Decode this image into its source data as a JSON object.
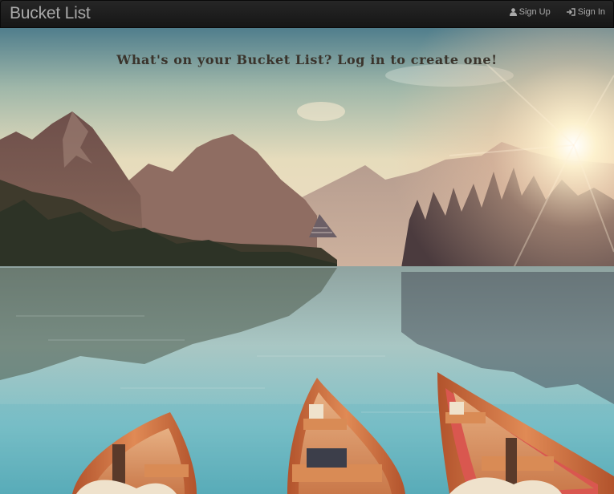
{
  "navbar": {
    "brand": "Bucket List",
    "links": [
      {
        "label": "Sign Up",
        "icon": "user-icon"
      },
      {
        "label": "Sign In",
        "icon": "sign-in-icon"
      }
    ]
  },
  "hero": {
    "headline": "What's on your Bucket List? Log in to create one!",
    "background": "mountain-lake-sunset-canoes-photo"
  },
  "colors": {
    "navbar_bg": "#1f1f1f",
    "nav_text": "#a9a9a9",
    "headline": "#3a342c",
    "boat": "#c9663a"
  }
}
